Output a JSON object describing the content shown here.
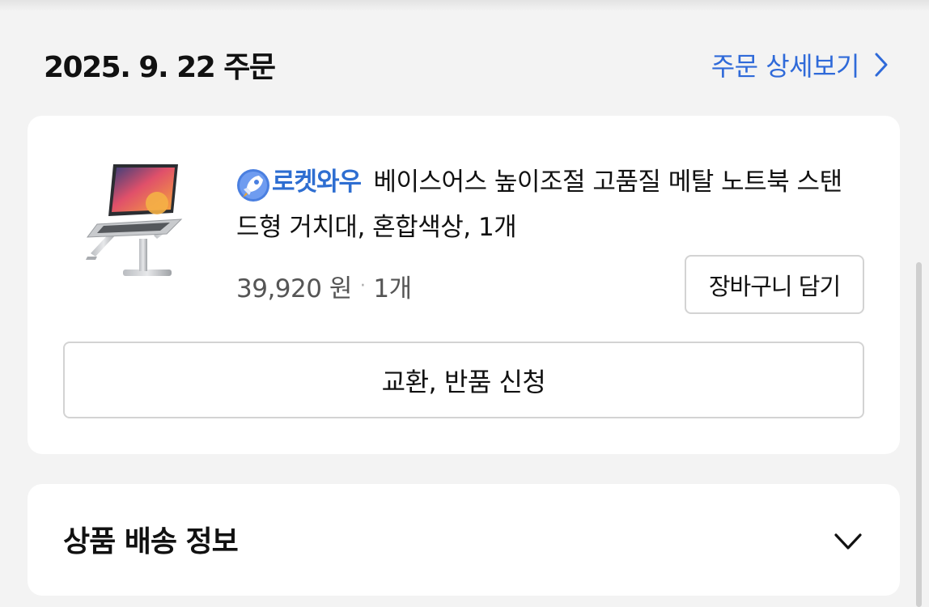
{
  "order": {
    "date_title": "2025. 9. 22 주문",
    "detail_link": "주문 상세보기"
  },
  "product": {
    "badge_label": "로켓와우",
    "title": "베이스어스 높이조절 고품질 메탈 노트북 스탠드형 거치대, 혼합색상, 1개",
    "price": "39,920 원",
    "quantity": "1개",
    "cart_button": "장바구니 담기",
    "return_button": "교환, 반품 신청"
  },
  "shipping": {
    "title": "상품 배송 정보"
  },
  "icons": {
    "detail_arrow": "chevron-right-icon",
    "rocket": "rocket-wow-icon",
    "shipping_toggle": "chevron-down-icon"
  },
  "colors": {
    "link": "#2f6ad9",
    "badge": "#2e6ed1",
    "background": "#f3f3f3",
    "card": "#ffffff"
  }
}
